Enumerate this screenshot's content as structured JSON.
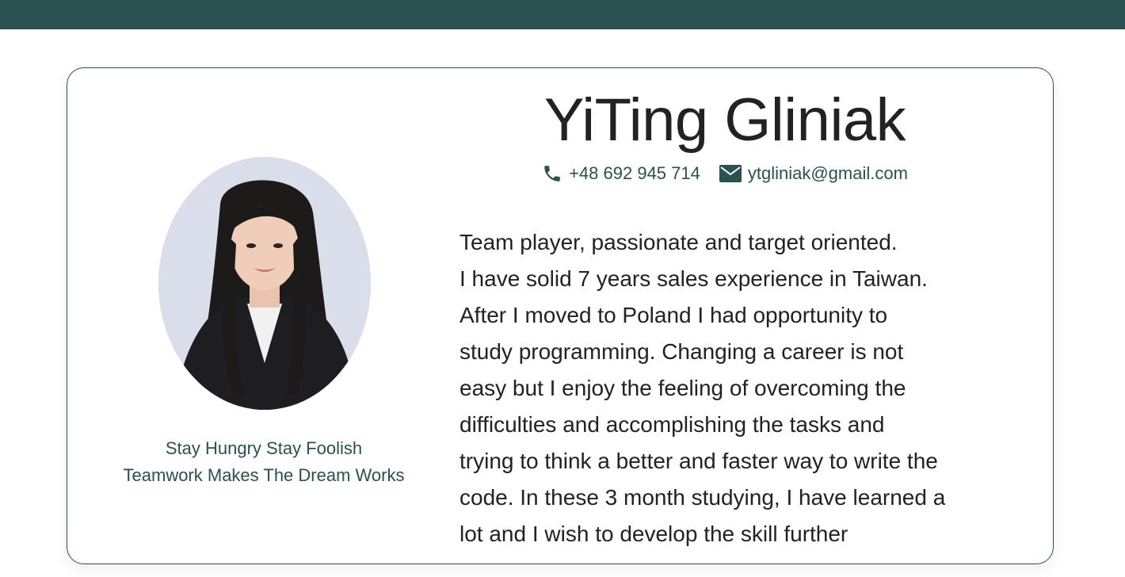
{
  "profile": {
    "name": "YiTing Gliniak",
    "phone": "+48 692 945 714",
    "email": "ytgliniak@gmail.com",
    "motto": [
      "Stay Hungry Stay Foolish",
      "Teamwork Makes The Dream Works"
    ],
    "bio_lines": [
      "Team player, passionate and target oriented.",
      "I have solid 7 years sales experience in Taiwan.",
      "After I moved to Poland I had opportunity to",
      "study programming. Changing a career is not",
      "easy but I enjoy the feeling of overcoming the",
      "difficulties and accomplishing the tasks and",
      "trying to think a better and faster way to write the",
      "code. In these 3 month studying, I have learned a",
      "lot and I wish to develop the skill further"
    ]
  },
  "icons": {
    "phone": "phone-icon",
    "email": "envelope-icon"
  },
  "colors": {
    "accent": "#2a5150",
    "text": "#222222",
    "background": "#ffffff"
  }
}
